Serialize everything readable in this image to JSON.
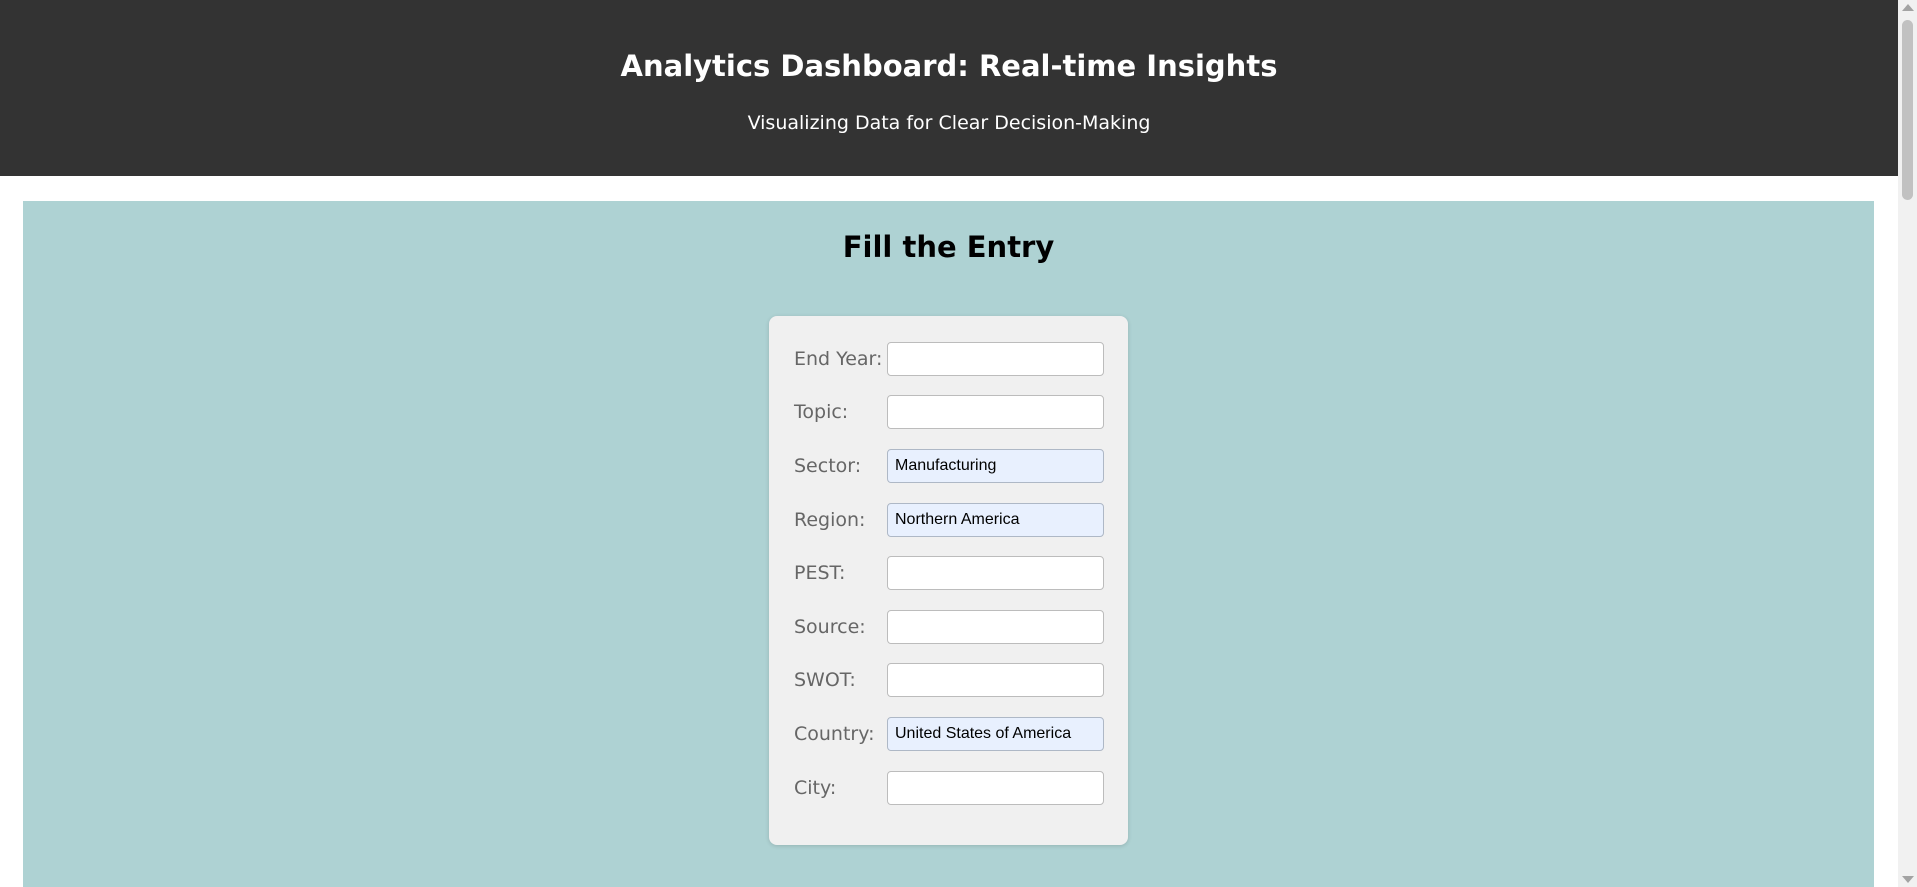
{
  "header": {
    "title": "Analytics Dashboard: Real-time Insights",
    "subtitle": "Visualizing Data for Clear Decision-Making"
  },
  "form": {
    "heading": "Fill the Entry",
    "fields": [
      {
        "label": "End Year:",
        "value": ""
      },
      {
        "label": "Topic:",
        "value": ""
      },
      {
        "label": "Sector:",
        "value": "Manufacturing"
      },
      {
        "label": "Region:",
        "value": "Northern America"
      },
      {
        "label": "PEST:",
        "value": ""
      },
      {
        "label": "Source:",
        "value": ""
      },
      {
        "label": "SWOT:",
        "value": ""
      },
      {
        "label": "Country:",
        "value": "United States of America"
      },
      {
        "label": "City:",
        "value": ""
      }
    ]
  },
  "colors": {
    "header_bg": "#333333",
    "main_bg": "#aed2d3",
    "card_bg": "#f0f0f0",
    "autofill_bg": "#e8f0fe"
  }
}
